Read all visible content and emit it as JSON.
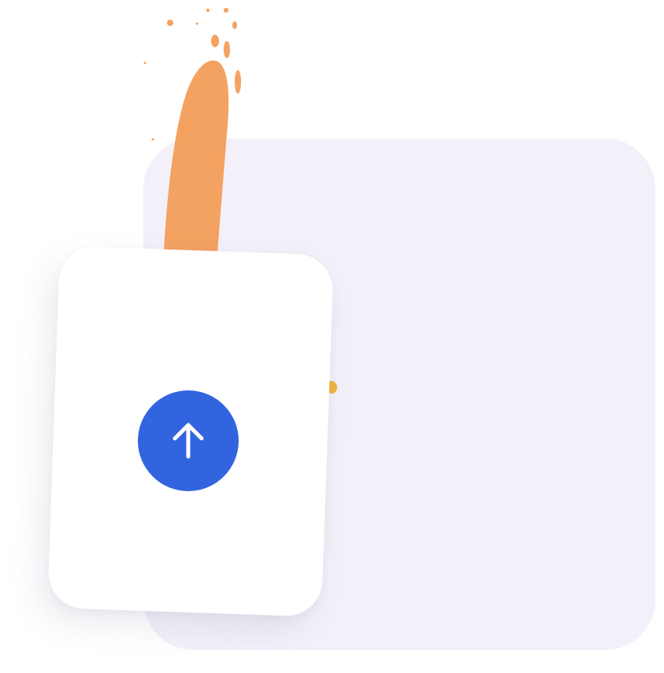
{
  "colors": {
    "panel": "#f3f0f9",
    "card": "#ffffff",
    "splash": "#f4a261",
    "accent_dot": "#f2b33d",
    "upload_button": "#3364e0",
    "upload_arrow": "#ffffff"
  },
  "icons": {
    "upload": "arrow-up-icon"
  }
}
